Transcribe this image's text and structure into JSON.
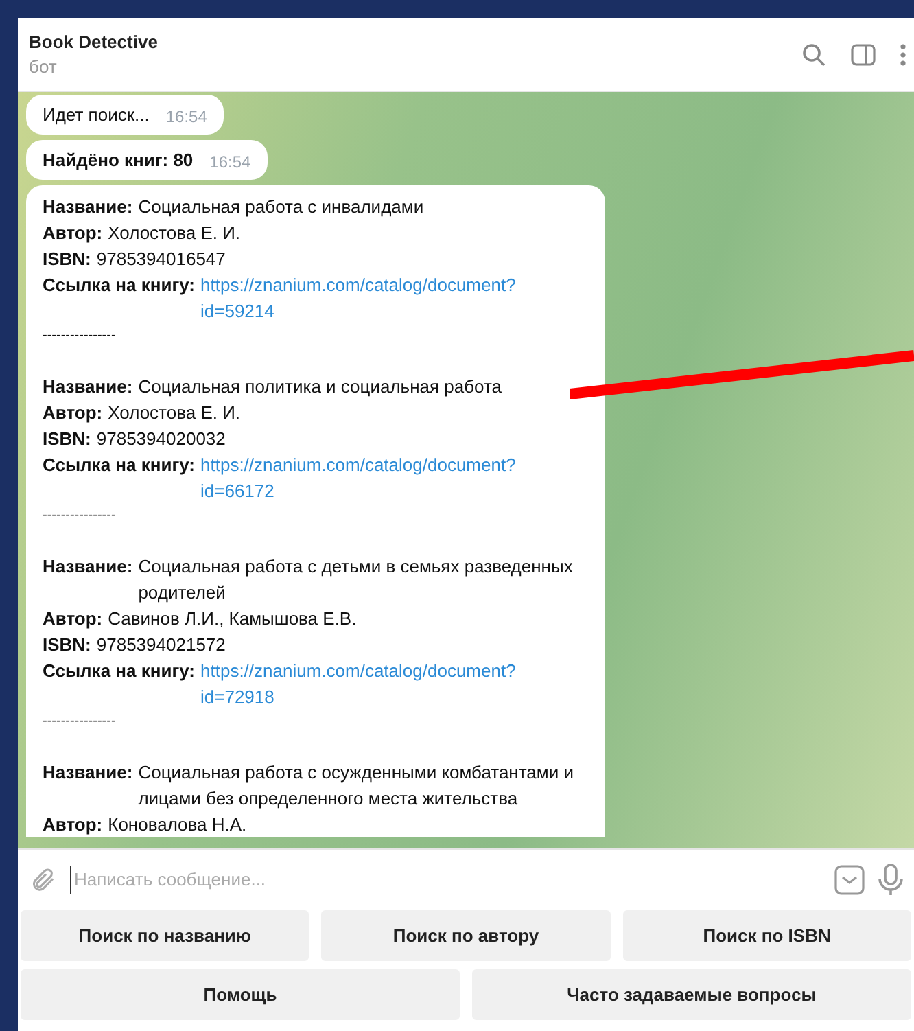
{
  "header": {
    "title": "Book Detective",
    "subtitle": "бот"
  },
  "messages": [
    {
      "kind": "plain",
      "text": "Идет поиск...",
      "time": "16:54"
    },
    {
      "kind": "bold",
      "text": "Найдёно книг: 80",
      "time": "16:54"
    },
    {
      "kind": "books",
      "books": [
        {
          "fields": [
            {
              "label": "Название:",
              "value": "Социальная работа с инвалидами"
            },
            {
              "label": "Автор:",
              "value": "Холостова Е. И."
            },
            {
              "label": "ISBN:",
              "value": "9785394016547"
            },
            {
              "label": "Ссылка на книгу:",
              "link": "https://znanium.com/catalog/document?id=59214"
            }
          ],
          "separator": "----------------"
        },
        {
          "fields": [
            {
              "label": "Название:",
              "value": "Социальная политика и социальная работа"
            },
            {
              "label": "Автор:",
              "value": "Холостова Е. И."
            },
            {
              "label": "ISBN:",
              "value": "9785394020032"
            },
            {
              "label": "Ссылка на книгу:",
              "link": "https://znanium.com/catalog/document?id=66172"
            }
          ],
          "separator": "----------------"
        },
        {
          "fields": [
            {
              "label": "Название:",
              "value": "Социальная работа с детьми в семьях разведенных родителей"
            },
            {
              "label": "Автор:",
              "value": "Савинов Л.И., Камышова Е.В."
            },
            {
              "label": "ISBN:",
              "value": "9785394021572"
            },
            {
              "label": "Ссылка на книгу:",
              "link": "https://znanium.com/catalog/document?id=72918"
            }
          ],
          "separator": "----------------"
        },
        {
          "fields": [
            {
              "label": "Название:",
              "value": "Социальная работа с осужденными комбатантами и лицами без определенного места жительства"
            },
            {
              "label": "Автор:",
              "value": "Коновалова Н.А."
            }
          ]
        }
      ]
    }
  ],
  "composer": {
    "placeholder": "Написать сообщение..."
  },
  "keyboard": [
    [
      "Поиск по названию",
      "Поиск по автору",
      "Поиск по ISBN"
    ],
    [
      "Помощь",
      "Часто задаваемые вопросы"
    ]
  ]
}
